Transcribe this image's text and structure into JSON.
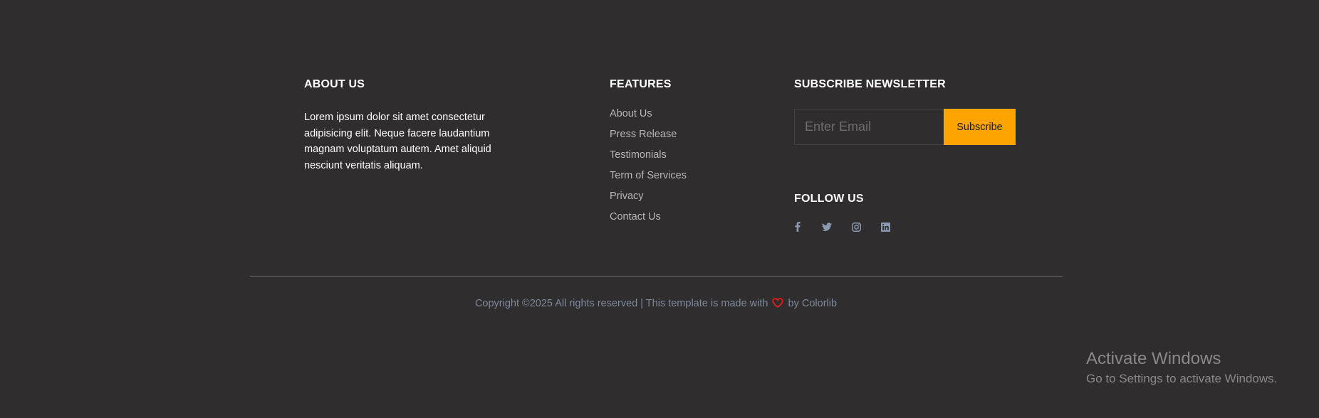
{
  "about": {
    "title": "ABOUT US",
    "text": "Lorem ipsum dolor sit amet consectetur adipisicing elit. Neque facere laudantium magnam voluptatum autem. Amet aliquid nesciunt veritatis aliquam."
  },
  "features": {
    "title": "FEATURES",
    "links": [
      "About Us",
      "Press Release",
      "Testimonials",
      "Term of Services",
      "Privacy",
      "Contact Us"
    ]
  },
  "newsletter": {
    "title": "SUBSCRIBE NEWSLETTER",
    "email_placeholder": "Enter Email",
    "email_value": "",
    "subscribe_label": "Subscribe"
  },
  "follow": {
    "title": "FOLLOW US",
    "icons": [
      "facebook-icon",
      "twitter-icon",
      "instagram-icon",
      "linkedin-icon"
    ]
  },
  "copyright": {
    "prefix": "Copyright ©2025 All rights reserved | This template is made with",
    "by": "by",
    "brand": "Colorlib"
  },
  "watermark": {
    "title": "Activate Windows",
    "subtitle": "Go to Settings to activate Windows."
  },
  "colors": {
    "background": "#2f2d2e",
    "accent": "#fea401",
    "heart": "#e0201b",
    "link": "#b7b7b7",
    "muted": "#7d8a9c"
  }
}
